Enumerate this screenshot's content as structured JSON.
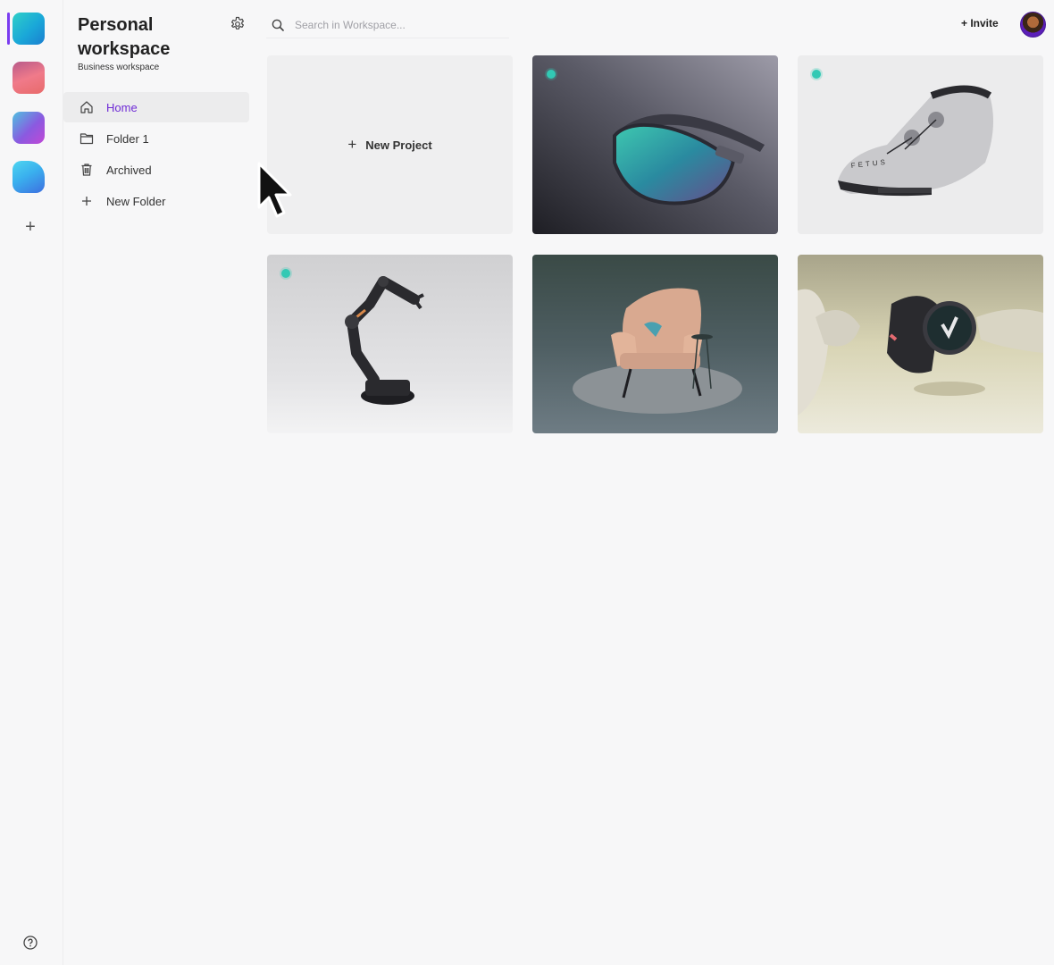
{
  "workspace": {
    "title": "Personal workspace",
    "subtitle": "Business workspace"
  },
  "rail": {
    "workspaces": [
      {
        "name": "workspace-1",
        "colors": [
          "#18b9d6",
          "#1e8bd6"
        ],
        "active": true
      },
      {
        "name": "workspace-2",
        "colors": [
          "#f07a8a",
          "#b44a7a"
        ],
        "active": false
      },
      {
        "name": "workspace-3",
        "colors": [
          "#5aa8e6",
          "#a548d6"
        ],
        "active": false
      },
      {
        "name": "workspace-4",
        "colors": [
          "#48d0ec",
          "#3a6fe0"
        ],
        "active": false
      }
    ],
    "add_symbol": "+",
    "help_icon": "help-icon"
  },
  "nav": [
    {
      "label": "Home",
      "icon": "home-icon",
      "active": true
    },
    {
      "label": "Folder 1",
      "icon": "folder-icon",
      "active": false
    },
    {
      "label": "Archived",
      "icon": "trash-icon",
      "active": false
    },
    {
      "label": "New Folder",
      "icon": "plus-icon",
      "active": false
    }
  ],
  "search": {
    "placeholder": "Search in Workspace..."
  },
  "header": {
    "invite_label": "+ Invite"
  },
  "projects": {
    "new_label": "New Project",
    "items": [
      {
        "name": "sunglasses"
      },
      {
        "name": "cycling-shoe"
      },
      {
        "name": "robot-arm"
      },
      {
        "name": "armchair"
      },
      {
        "name": "smartwatch"
      }
    ]
  },
  "colors": {
    "accent": "#6f2bd6",
    "status_dot": "#32c9b4"
  }
}
